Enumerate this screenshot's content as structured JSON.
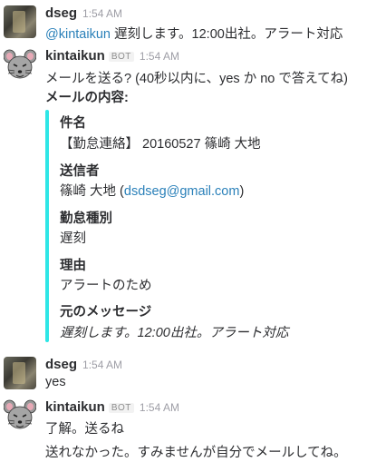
{
  "messages": [
    {
      "user": "dseg",
      "time": "1:54 AM",
      "mention": "@kintaikun",
      "text": " 遅刻します。12:00出社。アラート対応"
    },
    {
      "user": "kintaikun",
      "bot_label": "BOT",
      "time": "1:54 AM",
      "text": "メールを送る? (40秒以内に、yes か no で答えてね)",
      "heading": "メールの内容:"
    },
    {
      "user": "dseg",
      "time": "1:54 AM",
      "text": "yes"
    },
    {
      "user": "kintaikun",
      "bot_label": "BOT",
      "time": "1:54 AM",
      "text": "了解。送るね",
      "text2": "送れなかった。すみませんが自分でメールしてね。"
    }
  ],
  "attachment": {
    "accent_color": "#2ee6e6",
    "fields": [
      {
        "title": "件名",
        "value": "【勤怠連絡】 20160527 篠崎 大地"
      },
      {
        "title": "送信者",
        "value_prefix": "篠崎 大地 (",
        "value_link": "dsdseg@gmail.com",
        "value_suffix": ")"
      },
      {
        "title": "勤怠種別",
        "value": "遅刻"
      },
      {
        "title": "理由",
        "value": "アラートのため"
      },
      {
        "title": "元のメッセージ",
        "value": "遅刻します。12:00出社。アラート対応"
      }
    ]
  },
  "icons": {
    "user_avatar": "user-photo-avatar",
    "bot_avatar": "mouse-bot-avatar"
  }
}
